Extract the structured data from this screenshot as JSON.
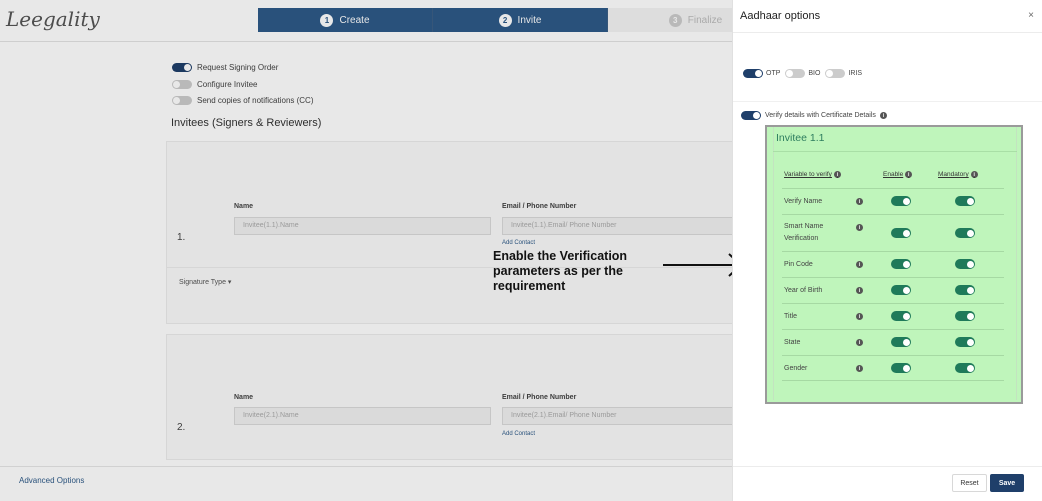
{
  "header": {
    "logo_text": "Leegality",
    "steps": [
      {
        "num": "1",
        "label": "Create"
      },
      {
        "num": "2",
        "label": "Invite"
      },
      {
        "num": "3",
        "label": "Finalize"
      }
    ]
  },
  "options": {
    "request_signing_order": "Request Signing Order",
    "configure_invitee": "Configure Invitee",
    "send_copies": "Send copies of notifications (CC)"
  },
  "section_title": "Invitees (Signers & Reviewers)",
  "invitees": [
    {
      "index": "1.",
      "name_label": "Name",
      "name_placeholder": "Invitee(1.1).Name",
      "email_label": "Email / Phone Number",
      "email_placeholder": "Invitee(1.1).Email/ Phone Number",
      "add_contact": "Add Contact",
      "signature_type": "Signature Type"
    },
    {
      "index": "2.",
      "name_label": "Name",
      "name_placeholder": "Invitee(2.1).Name",
      "email_label": "Email / Phone Number",
      "email_placeholder": "Invitee(2.1).Email/ Phone Number",
      "add_contact": "Add Contact"
    }
  ],
  "advanced_options": "Advanced Options",
  "annotation": "Enable the Verification parameters as per the requirement",
  "drawer": {
    "title": "Aadhaar options",
    "close": "×",
    "auth_modes": [
      {
        "label": "OTP",
        "on": true
      },
      {
        "label": "BIO",
        "on": false
      },
      {
        "label": "IRIS",
        "on": false
      }
    ],
    "verify_label": "Verify details with Certificate Details",
    "invitee_title": "Invitee 1.1",
    "columns": {
      "variable": "Variable to verify",
      "enable": "Enable",
      "mandatory": "Mandatory"
    },
    "rows": [
      {
        "name": "Verify Name"
      },
      {
        "name": "Smart Name Verification"
      },
      {
        "name": "Pin Code"
      },
      {
        "name": "Year of Birth"
      },
      {
        "name": "Title"
      },
      {
        "name": "State"
      },
      {
        "name": "Gender"
      }
    ],
    "reset_label": "Reset",
    "save_label": "Save"
  },
  "colors": {
    "primary": "#2e5a88",
    "toggle_green": "#1f7a5a",
    "highlight": "#bff5bb"
  }
}
